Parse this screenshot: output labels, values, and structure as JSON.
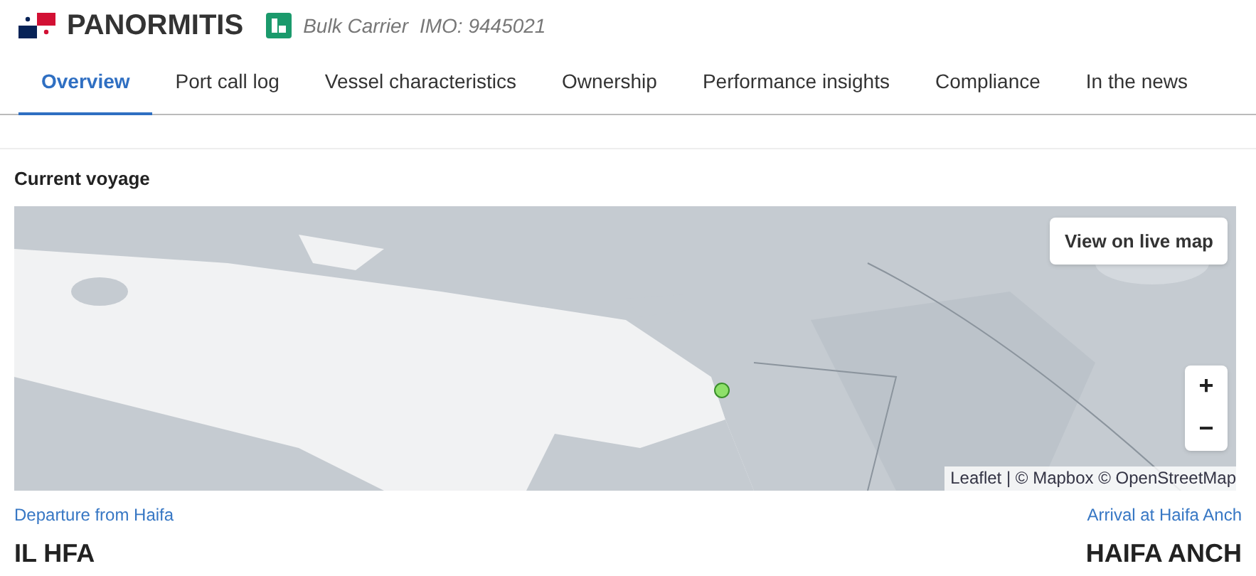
{
  "vessel": {
    "name": "PANORMITIS",
    "type": "Bulk Carrier",
    "imo": "IMO: 9445021"
  },
  "tabs": [
    {
      "label": "Overview",
      "selected": true
    },
    {
      "label": "Port call log",
      "selected": false
    },
    {
      "label": "Vessel characteristics",
      "selected": false
    },
    {
      "label": "Ownership",
      "selected": false
    },
    {
      "label": "Performance insights",
      "selected": false
    },
    {
      "label": "Compliance",
      "selected": false
    },
    {
      "label": "In the news",
      "selected": false
    }
  ],
  "section": {
    "title": "Current voyage"
  },
  "map": {
    "live_map_button": "View on live map",
    "zoom_in": "+",
    "zoom_out": "−",
    "attribution": "Leaflet | © Mapbox © OpenStreetMap"
  },
  "departure": {
    "label": "Departure from Haifa",
    "port": "IL HFA"
  },
  "arrival": {
    "label": "Arrival at Haifa Anch",
    "port": "HAIFA ANCH"
  }
}
